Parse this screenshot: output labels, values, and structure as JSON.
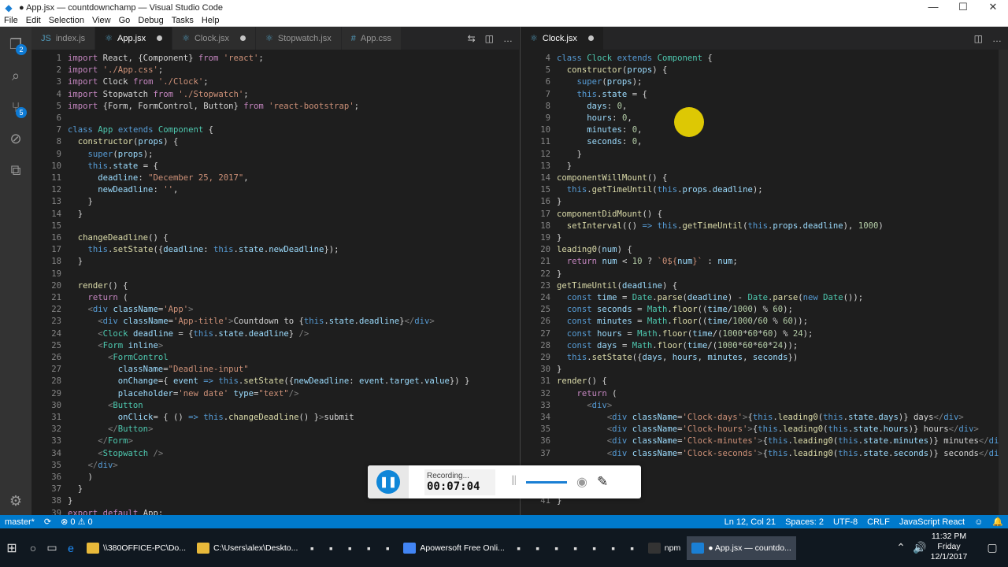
{
  "window": {
    "title": "● App.jsx — countdownchamp — Visual Studio Code",
    "minimize": "—",
    "maximize": "☐",
    "close": "✕"
  },
  "menu": [
    "File",
    "Edit",
    "Selection",
    "View",
    "Go",
    "Debug",
    "Tasks",
    "Help"
  ],
  "activity": {
    "explorer_badge": "2",
    "scm_badge": "5"
  },
  "left_tabs": [
    {
      "icon": "JS",
      "label": "index.js",
      "dirty": false,
      "active": false
    },
    {
      "icon": "⚛",
      "label": "App.jsx",
      "dirty": true,
      "active": true
    },
    {
      "icon": "⚛",
      "label": "Clock.jsx",
      "dirty": true,
      "active": false
    },
    {
      "icon": "⚛",
      "label": "Stopwatch.jsx",
      "dirty": false,
      "active": false
    },
    {
      "icon": "#",
      "label": "App.css",
      "dirty": false,
      "active": false
    }
  ],
  "right_tabs": [
    {
      "icon": "⚛",
      "label": "Clock.jsx",
      "dirty": true,
      "active": true
    }
  ],
  "left_code": [
    {
      "n": "1",
      "html": "<span class=k>import</span> React, {Component} <span class=k>from</span> <span class=s>'react'</span>;"
    },
    {
      "n": "2",
      "html": "<span class=k>import</span> <span class=s>'./App.css'</span>;"
    },
    {
      "n": "3",
      "html": "<span class=k>import</span> Clock <span class=k>from</span> <span class=s>'./Clock'</span>;"
    },
    {
      "n": "4",
      "html": "<span class=k>import</span> Stopwatch <span class=k>from</span> <span class=s>'./Stopwatch'</span>;"
    },
    {
      "n": "5",
      "html": "<span class=k>import</span> {Form, FormControl, Button} <span class=k>from</span> <span class=s>'react-bootstrap'</span>;"
    },
    {
      "n": "6",
      "html": ""
    },
    {
      "n": "7",
      "html": "<span class=tag>class</span> <span class=t>App</span> <span class=tag>extends</span> <span class=t>Component</span> {"
    },
    {
      "n": "8",
      "html": "  <span class=f>constructor</span>(<span class=v>props</span>) {"
    },
    {
      "n": "9",
      "html": "    <span class=tag>super</span>(<span class=v>props</span>);"
    },
    {
      "n": "10",
      "html": "    <span class=tag>this</span>.<span class=v>state</span> = {"
    },
    {
      "n": "11",
      "html": "      <span class=v>deadline</span>: <span class=s>\"December 25, 2017\"</span>,"
    },
    {
      "n": "12",
      "html": "      <span class=v>newDeadline</span>: <span class=s>''</span>,"
    },
    {
      "n": "13",
      "html": "    }"
    },
    {
      "n": "14",
      "html": "  }"
    },
    {
      "n": "15",
      "html": ""
    },
    {
      "n": "16",
      "html": "  <span class=f>changeDeadline</span>() {"
    },
    {
      "n": "17",
      "html": "    <span class=tag>this</span>.<span class=f>setState</span>({<span class=v>deadline</span>: <span class=tag>this</span>.<span class=v>state</span>.<span class=v>newDeadline</span>});"
    },
    {
      "n": "18",
      "html": "  }"
    },
    {
      "n": "19",
      "html": ""
    },
    {
      "n": "20",
      "html": "  <span class=f>render</span>() {"
    },
    {
      "n": "21",
      "html": "    <span class=k>return</span> ("
    },
    {
      "n": "22",
      "html": "    <span class=tg>&lt;</span><span class=tag>div</span> <span class=v>className</span>=<span class=s>'App'</span><span class=tg>&gt;</span>"
    },
    {
      "n": "23",
      "html": "      <span class=tg>&lt;</span><span class=tag>div</span> <span class=v>className</span>=<span class=s>'App-title'</span><span class=tg>&gt;</span>Countdown to {<span class=tag>this</span>.<span class=v>state</span>.<span class=v>deadline</span>}<span class=tg>&lt;/</span><span class=tag>div</span><span class=tg>&gt;</span>"
    },
    {
      "n": "24",
      "html": "      <span class=tg>&lt;</span><span class=t>Clock</span> <span class=v>deadline</span> = {<span class=tag>this</span>.<span class=v>state</span>.<span class=v>deadline</span>} <span class=tg>/&gt;</span>"
    },
    {
      "n": "25",
      "html": "      <span class=tg>&lt;</span><span class=t>Form</span> <span class=v>inline</span><span class=tg>&gt;</span>"
    },
    {
      "n": "26",
      "html": "        <span class=tg>&lt;</span><span class=t>FormControl</span>"
    },
    {
      "n": "27",
      "html": "          <span class=v>className</span>=<span class=s>\"Deadline-input\"</span>"
    },
    {
      "n": "28",
      "html": "          <span class=v>onChange</span>={ <span class=v>event</span> <span class=tag>=&gt;</span> <span class=tag>this</span>.<span class=f>setState</span>({<span class=v>newDeadline</span>: <span class=v>event</span>.<span class=v>target</span>.<span class=v>value</span>}) }"
    },
    {
      "n": "29",
      "html": "          <span class=v>placeholder</span>=<span class=s>'new date'</span> <span class=v>type</span>=<span class=s>\"text\"</span><span class=tg>/&gt;</span>"
    },
    {
      "n": "30",
      "html": "        <span class=tg>&lt;</span><span class=t>Button</span>"
    },
    {
      "n": "31",
      "html": "          <span class=v>onClick</span>= { () <span class=tag>=&gt;</span> <span class=tag>this</span>.<span class=f>changeDeadline</span>() }<span class=tg>&gt;</span>submit"
    },
    {
      "n": "32",
      "html": "        <span class=tg>&lt;/</span><span class=t>Button</span><span class=tg>&gt;</span>"
    },
    {
      "n": "33",
      "html": "      <span class=tg>&lt;/</span><span class=t>Form</span><span class=tg>&gt;</span>"
    },
    {
      "n": "34",
      "html": "      <span class=tg>&lt;</span><span class=t>Stopwatch</span> <span class=tg>/&gt;</span>"
    },
    {
      "n": "35",
      "html": "    <span class=tg>&lt;/</span><span class=tag>div</span><span class=tg>&gt;</span>"
    },
    {
      "n": "36",
      "html": "    )"
    },
    {
      "n": "37",
      "html": "  }"
    },
    {
      "n": "38",
      "html": "}"
    },
    {
      "n": "39",
      "html": "<span class=k>export</span> <span class=k>default</span> App;"
    }
  ],
  "right_code": [
    {
      "n": "4",
      "html": "<span class=tag>class</span> <span class=t>Clock</span> <span class=tag>extends</span> <span class=t>Component</span> {"
    },
    {
      "n": "5",
      "html": "  <span class=f>constructor</span>(<span class=v>props</span>) {"
    },
    {
      "n": "6",
      "html": "    <span class=tag>super</span>(<span class=v>props</span>);"
    },
    {
      "n": "7",
      "html": "    <span class=tag>this</span>.<span class=v>state</span> = {"
    },
    {
      "n": "8",
      "html": "      <span class=v>days</span>: <span class=n>0</span>,"
    },
    {
      "n": "9",
      "html": "      <span class=v>hours</span>: <span class=n>0</span>,"
    },
    {
      "n": "10",
      "html": "      <span class=v>minutes</span>: <span class=n>0</span>,"
    },
    {
      "n": "11",
      "html": "      <span class=v>seconds</span>: <span class=n>0</span>,"
    },
    {
      "n": "12",
      "html": "    }"
    },
    {
      "n": "13",
      "html": "  }"
    },
    {
      "n": "14",
      "html": "<span class=f>componentWillMount</span>() {"
    },
    {
      "n": "15",
      "html": "  <span class=tag>this</span>.<span class=f>getTimeUntil</span>(<span class=tag>this</span>.<span class=v>props</span>.<span class=v>deadline</span>);"
    },
    {
      "n": "16",
      "html": "}"
    },
    {
      "n": "17",
      "html": "<span class=f>componentDidMount</span>() {"
    },
    {
      "n": "18",
      "html": "  <span class=f>setInterval</span>(() <span class=tag>=&gt;</span> <span class=tag>this</span>.<span class=f>getTimeUntil</span>(<span class=tag>this</span>.<span class=v>props</span>.<span class=v>deadline</span>), <span class=n>1000</span>)"
    },
    {
      "n": "19",
      "html": "}"
    },
    {
      "n": "20",
      "html": "<span class=f>leading0</span>(<span class=v>num</span>) {"
    },
    {
      "n": "21",
      "html": "  <span class=k>return</span> <span class=v>num</span> &lt; <span class=n>10</span> ? <span class=s>`0${</span><span class=v>num</span><span class=s>}`</span> : <span class=v>num</span>;"
    },
    {
      "n": "22",
      "html": "}"
    },
    {
      "n": "23",
      "html": "<span class=f>getTimeUntil</span>(<span class=v>deadline</span>) {"
    },
    {
      "n": "24",
      "html": "  <span class=tag>const</span> <span class=v>time</span> = <span class=t>Date</span>.<span class=f>parse</span>(<span class=v>deadline</span>) - <span class=t>Date</span>.<span class=f>parse</span>(<span class=tag>new</span> <span class=t>Date</span>());"
    },
    {
      "n": "25",
      "html": "  <span class=tag>const</span> <span class=v>seconds</span> = <span class=t>Math</span>.<span class=f>floor</span>((<span class=v>time</span>/<span class=n>1000</span>) % <span class=n>60</span>);"
    },
    {
      "n": "26",
      "html": "  <span class=tag>const</span> <span class=v>minutes</span> = <span class=t>Math</span>.<span class=f>floor</span>((<span class=v>time</span>/<span class=n>1000</span>/<span class=n>60</span> % <span class=n>60</span>));"
    },
    {
      "n": "27",
      "html": "  <span class=tag>const</span> <span class=v>hours</span> = <span class=t>Math</span>.<span class=f>floor</span>(<span class=v>time</span>/(<span class=n>1000</span>*<span class=n>60</span>*<span class=n>60</span>) % <span class=n>24</span>);"
    },
    {
      "n": "28",
      "html": "  <span class=tag>const</span> <span class=v>days</span> = <span class=t>Math</span>.<span class=f>floor</span>(<span class=v>time</span>/(<span class=n>1000</span>*<span class=n>60</span>*<span class=n>60</span>*<span class=n>24</span>));"
    },
    {
      "n": "29",
      "html": "  <span class=tag>this</span>.<span class=f>setState</span>({<span class=v>days</span>, <span class=v>hours</span>, <span class=v>minutes</span>, <span class=v>seconds</span>})"
    },
    {
      "n": "30",
      "html": "}"
    },
    {
      "n": "31",
      "html": "<span class=f>render</span>() {"
    },
    {
      "n": "32",
      "html": "    <span class=k>return</span> ("
    },
    {
      "n": "33",
      "html": "      <span class=tg>&lt;</span><span class=tag>div</span><span class=tg>&gt;</span>"
    },
    {
      "n": "34",
      "html": "          <span class=tg>&lt;</span><span class=tag>div</span> <span class=v>className</span>=<span class=s>'Clock-days'</span><span class=tg>&gt;</span>{<span class=tag>this</span>.<span class=f>leading0</span>(<span class=tag>this</span>.<span class=v>state</span>.<span class=v>days</span>)} days<span class=tg>&lt;/</span><span class=tag>div</span><span class=tg>&gt;</span>"
    },
    {
      "n": "35",
      "html": "          <span class=tg>&lt;</span><span class=tag>div</span> <span class=v>className</span>=<span class=s>'Clock-hours'</span><span class=tg>&gt;</span>{<span class=tag>this</span>.<span class=f>leading0</span>(<span class=tag>this</span>.<span class=v>state</span>.<span class=v>hours</span>)} hours<span class=tg>&lt;/</span><span class=tag>div</span><span class=tg>&gt;</span>"
    },
    {
      "n": "36",
      "html": "          <span class=tg>&lt;</span><span class=tag>div</span> <span class=v>className</span>=<span class=s>'Clock-minutes'</span><span class=tg>&gt;</span>{<span class=tag>this</span>.<span class=f>leading0</span>(<span class=tag>this</span>.<span class=v>state</span>.<span class=v>minutes</span>)} minutes<span class=tg>&lt;/</span><span class=tag>div</span><span class=tg>&gt;</span>"
    },
    {
      "n": "37",
      "html": "          <span class=tg>&lt;</span><span class=tag>div</span> <span class=v>className</span>=<span class=s>'Clock-seconds'</span><span class=tg>&gt;</span>{<span class=tag>this</span>.<span class=f>leading0</span>(<span class=tag>this</span>.<span class=v>state</span>.<span class=v>seconds</span>)} seconds<span class=tg>&lt;/</span><span class=tag>div</span><span class=tg>&gt;</span>"
    },
    {
      "n": "41",
      "html": "}"
    }
  ],
  "status": {
    "branch": "master*",
    "sync": "⟳",
    "problems": "⊗ 0 ⚠ 0",
    "position": "Ln 12, Col 21",
    "spaces": "Spaces: 2",
    "encoding": "UTF-8",
    "eol": "CRLF",
    "language": "JavaScript React"
  },
  "recorder": {
    "label": "Recording...",
    "time": "00:07:04"
  },
  "taskbar": {
    "apps": [
      {
        "label": "\\\\380OFFICE-PC\\Do...",
        "color": "#e8b93a"
      },
      {
        "label": "C:\\Users\\alex\\Deskto...",
        "color": "#e8b93a"
      },
      {
        "label": "Apowersoft Free Onli...",
        "color": "#4285f4"
      },
      {
        "label": "npm",
        "color": "#333333"
      },
      {
        "label": "● App.jsx — countdo...",
        "color": "#1a7fd4"
      }
    ],
    "time": "11:32 PM",
    "day": "Friday",
    "date": "12/1/2017"
  },
  "colors": {
    "accent": "#007acc",
    "editor_bg": "#1e1e1e",
    "activity_bg": "#333333",
    "taskbar_bg": "#101820"
  }
}
